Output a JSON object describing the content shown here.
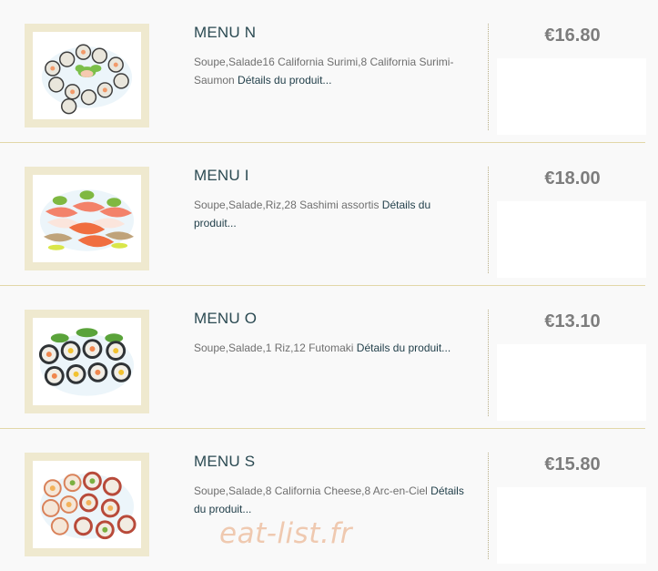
{
  "menus": [
    {
      "name": "MENU N",
      "description": "Soupe,Salade16 California Surimi,8 California Surimi-Saumon",
      "details_link": "Détails du produit...",
      "price": "€16.80"
    },
    {
      "name": "MENU I",
      "description": "Soupe,Salade,Riz,28 Sashimi assortis",
      "details_link": "Détails du produit...",
      "price": "€18.00"
    },
    {
      "name": "MENU O",
      "description": "Soupe,Salade,1 Riz,12 Futomaki",
      "details_link": "Détails du produit...",
      "price": "€13.10"
    },
    {
      "name": "MENU S",
      "description": "Soupe,Salade,8 California Cheese,8 Arc-en-Ciel",
      "details_link": "Détails du produit...",
      "price": "€15.80"
    }
  ],
  "watermark": "eat-list.fr",
  "colors": {
    "title": "#2b4a52",
    "price": "#7d7d7d",
    "frame": "#efe9cf",
    "separator": "#e2d7a8",
    "watermark": "#efc9b0"
  }
}
